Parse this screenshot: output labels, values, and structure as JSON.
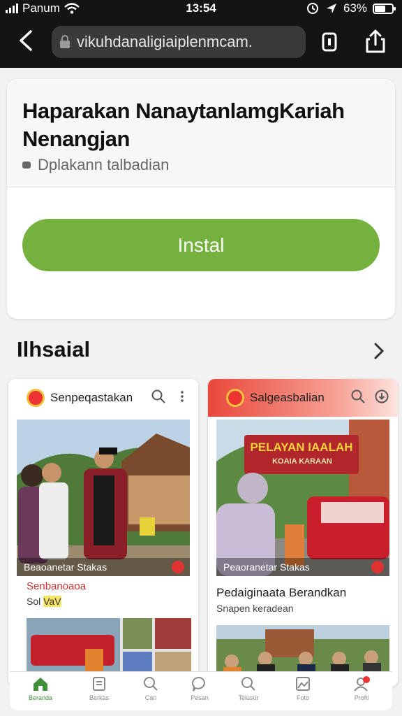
{
  "status": {
    "carrier": "Panum",
    "time": "13:54",
    "battery": "63%",
    "battery_level": 0.63
  },
  "browser": {
    "url": "vikuhdanaligiaiplenmcam."
  },
  "install_card": {
    "title": "Haparakan NanaytanlamgKariah Nenangjan",
    "subtitle": "Dplakann talbadian",
    "install_label": "Instal"
  },
  "section": {
    "title": "Ilhsaial"
  },
  "screenshots": [
    {
      "app_name": "Senpeqastakan",
      "caption": "Beaoanetar Stakas",
      "line1": "Senbanoaoa",
      "line2_prefix": "Sol ",
      "line2_highlight": "VaV"
    },
    {
      "app_name": "Salgeasbalian",
      "banner_line1": "PELAYAN IAALAH",
      "banner_line2": "KOAIA KARAAN",
      "caption": "Peaoranetar Stakas",
      "line1": "Pedaiginaata Berandkan",
      "line2": "Snapen keradean"
    }
  ],
  "bottom_nav": [
    {
      "icon": "home-icon",
      "label": "Beranda"
    },
    {
      "icon": "document-icon",
      "label": "Berkas"
    },
    {
      "icon": "search-icon",
      "label": "Cari"
    },
    {
      "icon": "chat-icon",
      "label": "Pesan"
    },
    {
      "icon": "search-icon",
      "label": "Telusur"
    },
    {
      "icon": "image-icon",
      "label": "Foto"
    },
    {
      "icon": "profile-icon",
      "label": "Profil",
      "badge": true
    }
  ],
  "colors": {
    "install": "#74b13e",
    "accent_red": "#e9483b",
    "chrome": "#141414"
  }
}
